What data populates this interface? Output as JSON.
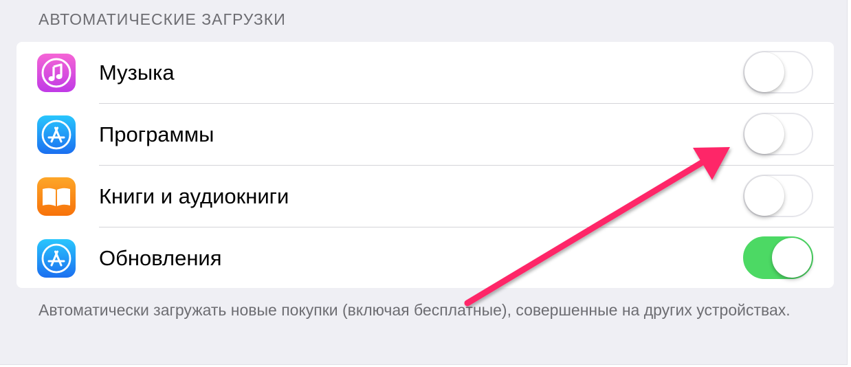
{
  "section_header": "АВТОМАТИЧЕСКИЕ ЗАГРУЗКИ",
  "rows": [
    {
      "label": "Музыка",
      "icon": "itunes-music-icon",
      "enabled": false
    },
    {
      "label": "Программы",
      "icon": "app-store-icon",
      "enabled": false
    },
    {
      "label": "Книги и аудиокниги",
      "icon": "ibooks-icon",
      "enabled": false
    },
    {
      "label": "Обновления",
      "icon": "app-store-icon",
      "enabled": true
    }
  ],
  "footer": "Автоматически загружать новые покупки (включая бесплатные), совершенные на других устройствах.",
  "colors": {
    "background": "#efeff4",
    "switch_on": "#4cd964",
    "switch_off_border": "#e5e5ea",
    "annotation_arrow": "#fe2667",
    "music_icon": "#d94be8",
    "app_store_icon": "#1d8cf4",
    "books_icon": "#fb8a0e"
  }
}
